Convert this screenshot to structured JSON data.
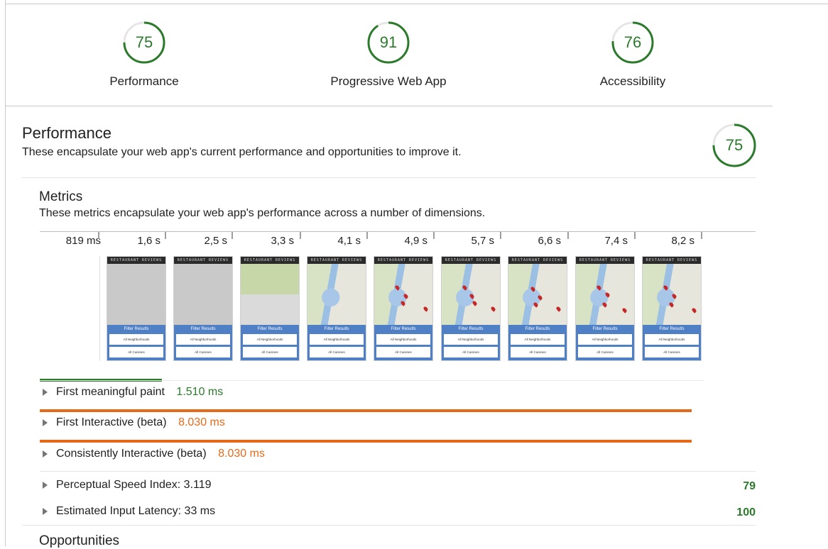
{
  "summary": {
    "gauges": [
      {
        "name": "performance",
        "score": "75",
        "label": "Performance",
        "fraction": 0.75
      },
      {
        "name": "pwa",
        "score": "91",
        "label": "Progressive Web App",
        "fraction": 0.91
      },
      {
        "name": "accessibility",
        "score": "76",
        "label": "Accessibility",
        "fraction": 0.76
      }
    ]
  },
  "performance": {
    "title": "Performance",
    "description": "These encapsulate your web app's current performance and opportunities to improve it.",
    "score": "75",
    "score_fraction": 0.75
  },
  "metrics": {
    "title": "Metrics",
    "description": "These metrics encapsulate your web app's performance across a number of dimensions.",
    "filmstrip_times": [
      "819 ms",
      "1,6 s",
      "2,5 s",
      "3,3 s",
      "4,1 s",
      "4,9 s",
      "5,7 s",
      "6,6 s",
      "7,4 s",
      "8,2 s"
    ],
    "frame_header": "RESTAURANT REVIEWS",
    "frame_filter_title": "Filter Results",
    "frame_neighborhoods": "All Neighborhoods",
    "frame_cuisines": "All Cuisines",
    "rows": [
      {
        "label": "First meaningful paint",
        "value": "1.510 ms",
        "status": "green",
        "bar_fraction": 0.17
      },
      {
        "label": "First Interactive (beta)",
        "value": "8.030 ms",
        "status": "orange",
        "bar_fraction": 0.91
      },
      {
        "label": "Consistently Interactive (beta)",
        "value": "8.030 ms",
        "status": "orange",
        "bar_fraction": 0.91
      },
      {
        "label": "Perceptual Speed Index: 3.119",
        "score": "79"
      },
      {
        "label": "Estimated Input Latency: 33 ms",
        "score": "100"
      }
    ]
  },
  "opportunities": {
    "title": "Opportunities"
  },
  "colors": {
    "pass": "#2c7a2c",
    "average": "#e46a1a",
    "filter": "#4f7fc5"
  }
}
